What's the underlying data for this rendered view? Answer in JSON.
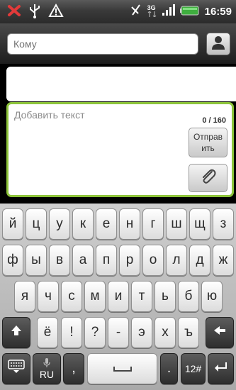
{
  "status_bar": {
    "icons": [
      "missed-call-icon",
      "usb-icon",
      "warning-icon",
      "no-signal-icon",
      "network-3g-icon",
      "signal-icon",
      "battery-icon"
    ],
    "network": "3G",
    "time": "16:59"
  },
  "recipient": {
    "placeholder": "Кому"
  },
  "compose": {
    "placeholder": "Добавить текст",
    "counter": "0 / 160",
    "send_label": "Отправ\nить"
  },
  "keyboard": {
    "row1": [
      "й",
      "ц",
      "у",
      "к",
      "е",
      "н",
      "г",
      "ш",
      "щ",
      "з"
    ],
    "row2": [
      "ф",
      "ы",
      "в",
      "а",
      "п",
      "р",
      "о",
      "л",
      "д",
      "ж"
    ],
    "row3": [
      "я",
      "ч",
      "с",
      "м",
      "и",
      "т",
      "ь",
      "б",
      "ю"
    ],
    "row4": [
      "ё",
      "!",
      "?",
      "-",
      "э",
      "х",
      "ъ"
    ],
    "lang_label": "RU",
    "comma_label": ",",
    "period_label": ".",
    "mode_label": "12#",
    "accent_color": "#8dc43a"
  }
}
